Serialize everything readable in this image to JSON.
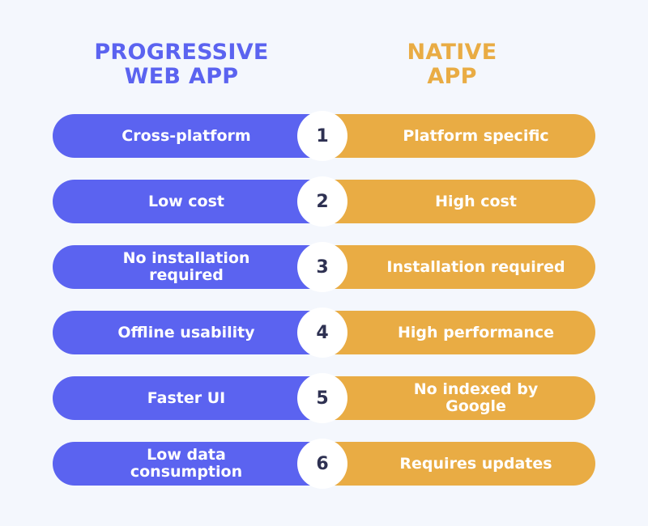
{
  "headers": {
    "left": [
      "PROGRESSIVE",
      "WEB APP"
    ],
    "right": [
      "NATIVE",
      "APP"
    ]
  },
  "colors": {
    "pwa": "#5b63f0",
    "native": "#e9ac44",
    "background": "#f4f7fd"
  },
  "rows": [
    {
      "num": "1",
      "pwa": "Cross-platform",
      "native": "Platform specific"
    },
    {
      "num": "2",
      "pwa": "Low cost",
      "native": "High cost"
    },
    {
      "num": "3",
      "pwa": "No installation required",
      "native": "Installation required"
    },
    {
      "num": "4",
      "pwa": "Offline usability",
      "native": "High performance"
    },
    {
      "num": "5",
      "pwa": "Faster UI",
      "native": "No indexed by Google"
    },
    {
      "num": "6",
      "pwa": "Low data consumption",
      "native": "Requires updates"
    }
  ]
}
